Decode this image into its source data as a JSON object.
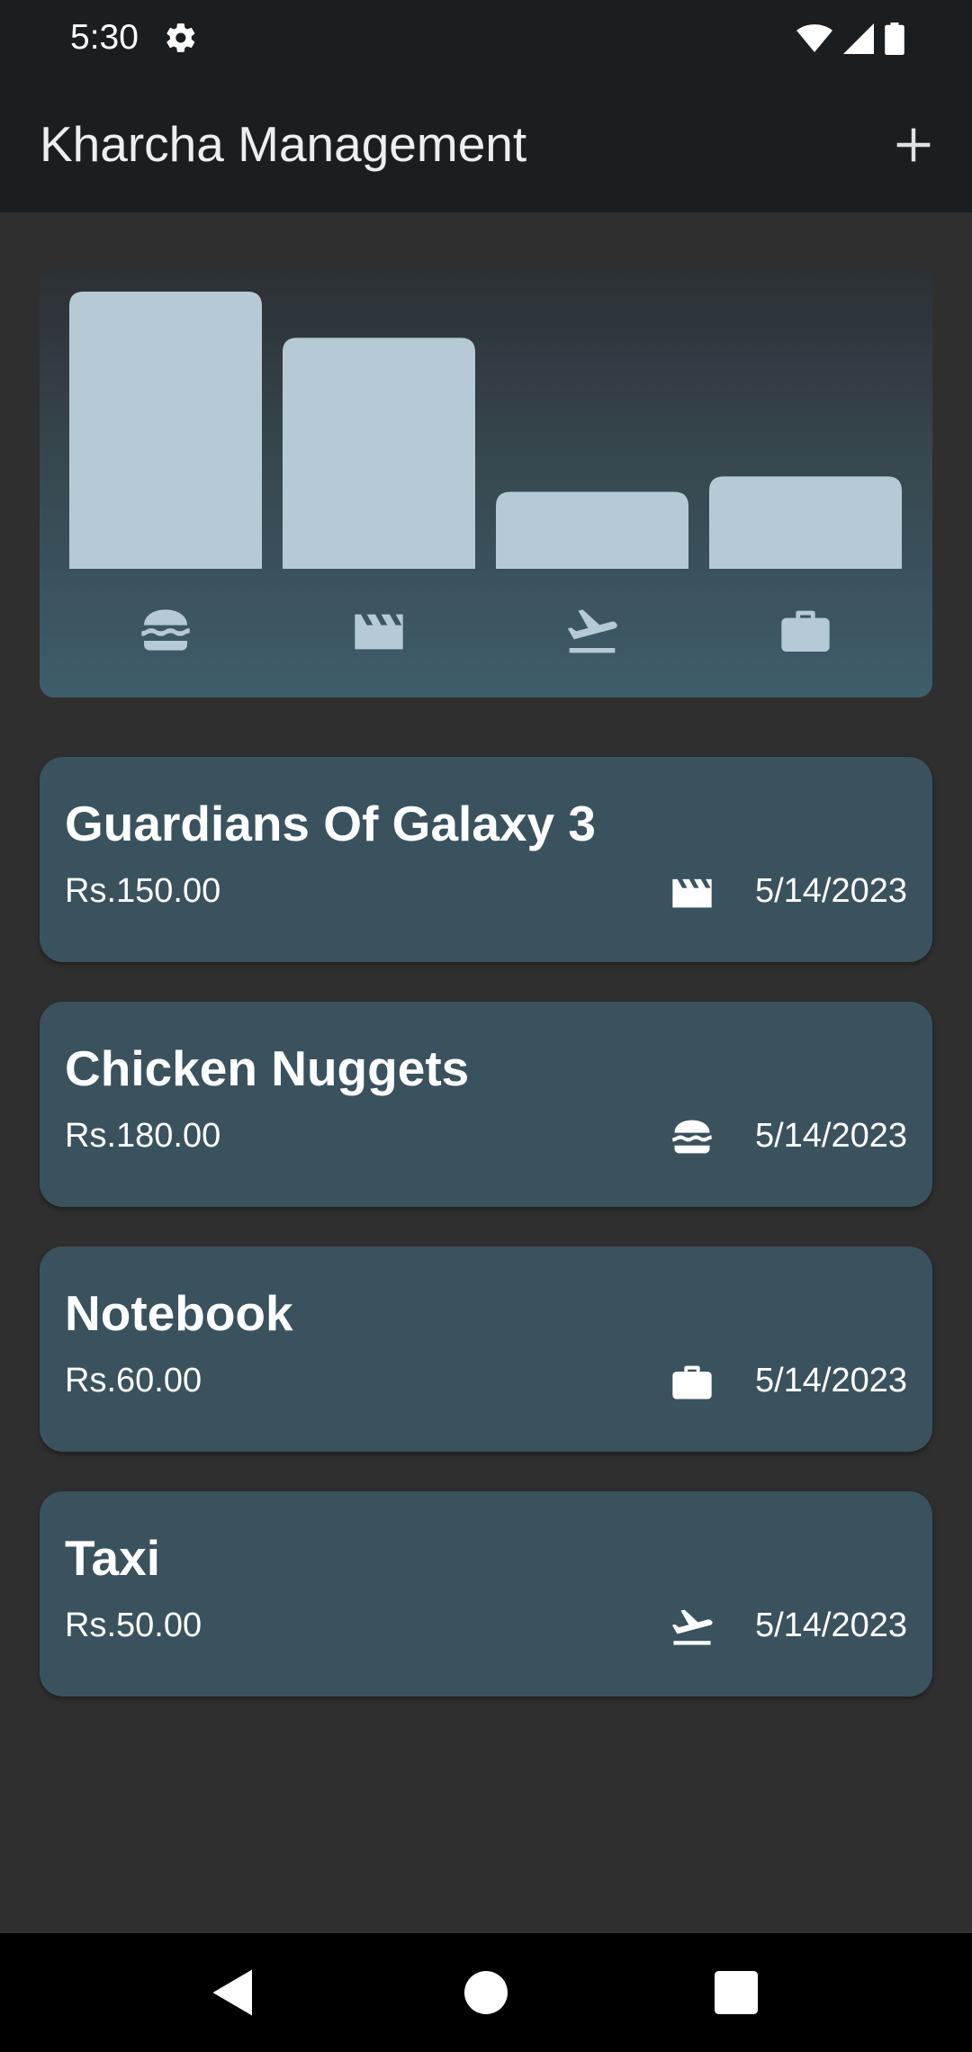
{
  "status_bar": {
    "time": "5:30",
    "icons": [
      "settings-icon",
      "wifi-icon",
      "signal-icon",
      "battery-icon"
    ]
  },
  "app_bar": {
    "title": "Kharcha Management",
    "add_icon": "plus-icon"
  },
  "chart_data": {
    "type": "bar",
    "categories": [
      "food",
      "movie",
      "travel",
      "work"
    ],
    "category_icons": [
      "burger-icon",
      "clapperboard-icon",
      "flight-takeoff-icon",
      "briefcase-icon"
    ],
    "values": [
      180,
      150,
      50,
      60
    ],
    "ylim": [
      0,
      180
    ],
    "bar_color": "#b5cad5"
  },
  "expenses": [
    {
      "title": "Guardians Of Galaxy 3",
      "amount": "Rs.150.00",
      "category_icon": "clapperboard-icon",
      "date": "5/14/2023"
    },
    {
      "title": "Chicken Nuggets",
      "amount": "Rs.180.00",
      "category_icon": "burger-icon",
      "date": "5/14/2023"
    },
    {
      "title": "Notebook",
      "amount": "Rs.60.00",
      "category_icon": "briefcase-icon",
      "date": "5/14/2023"
    },
    {
      "title": "Taxi",
      "amount": "Rs.50.00",
      "category_icon": "flight-takeoff-icon",
      "date": "5/14/2023"
    }
  ],
  "nav_bar": {
    "buttons": [
      "back-icon",
      "home-icon",
      "recents-icon"
    ]
  },
  "colors": {
    "background": "#2f2f2f",
    "app_bar": "#1b1e21",
    "card": "#3a525d",
    "accent_bar": "#b5cad5"
  }
}
